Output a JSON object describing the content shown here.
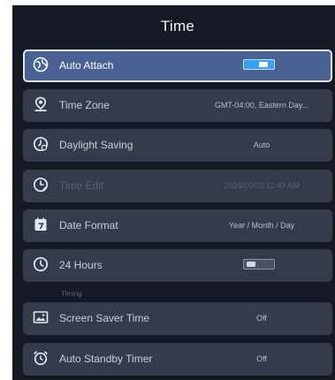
{
  "title": "Time",
  "rows": [
    {
      "label": "Auto Attach",
      "icon": "globe-sync-icon",
      "toggle": "on"
    },
    {
      "label": "Time Zone",
      "icon": "location-pin-icon",
      "value": "GMT-04:00, Eastern Day..."
    },
    {
      "label": "Daylight Saving",
      "icon": "clock-sun-icon",
      "value": "Auto"
    },
    {
      "label": "Time Edit",
      "icon": "clock-edit-icon",
      "value": "2024/09/03 11:49 AM"
    },
    {
      "label": "Date Format",
      "icon": "calendar-icon",
      "value": "Year / Month / Day"
    },
    {
      "label": "24 Hours",
      "icon": "clock-icon",
      "toggle": "off"
    }
  ],
  "section_title": "Timing",
  "timing_rows": [
    {
      "label": "Screen Saver Time",
      "icon": "screen-image-icon",
      "value": "Off"
    },
    {
      "label": "Auto Standby Timer",
      "icon": "alarm-clock-icon",
      "value": "Off"
    }
  ]
}
